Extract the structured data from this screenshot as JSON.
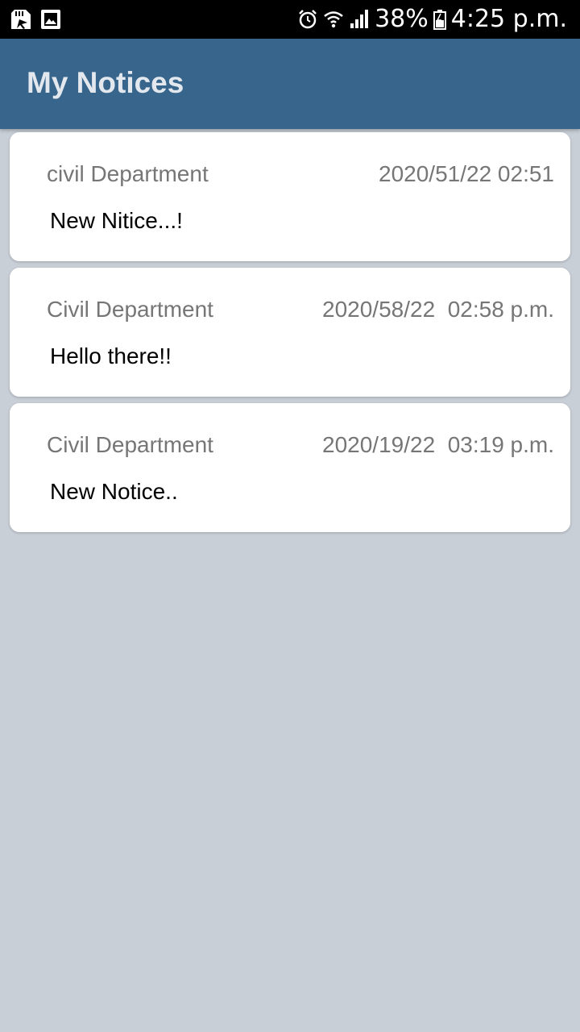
{
  "status_bar": {
    "left_icons": [
      "sd-card-icon",
      "image-icon"
    ],
    "right_icons": [
      "alarm-icon",
      "wifi-icon",
      "signal-icon",
      "battery-icon"
    ],
    "battery": "38%",
    "time": "4:25 p.m."
  },
  "app_bar": {
    "title": "My Notices",
    "color": "#37658b"
  },
  "notices": [
    {
      "department": "civil Department",
      "datetime": "2020/51/22 02:51",
      "message": "New Nitice...!"
    },
    {
      "department": "Civil Department",
      "datetime": "2020/58/22  02:58 p.m.",
      "message": "Hello there!!"
    },
    {
      "department": "Civil Department",
      "datetime": "2020/19/22  03:19 p.m.",
      "message": "New Notice.."
    }
  ],
  "colors": {
    "background": "#c8cfd7",
    "card": "#ffffff",
    "secondary_text": "#767676",
    "primary_text": "#000000"
  }
}
